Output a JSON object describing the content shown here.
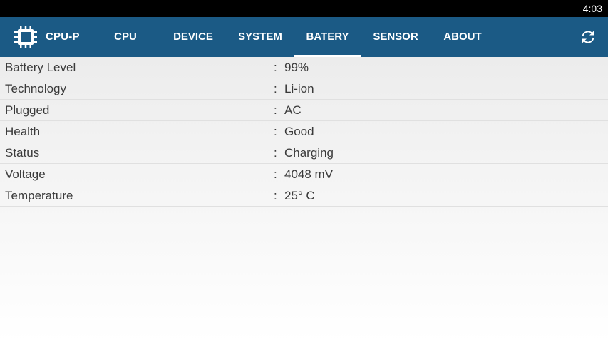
{
  "status_bar": {
    "time": "4:03"
  },
  "app_bar": {
    "title": "CPU-P",
    "tabs": [
      {
        "label": "CPU"
      },
      {
        "label": "DEVICE"
      },
      {
        "label": "SYSTEM"
      },
      {
        "label": "BATERY",
        "selected": true
      },
      {
        "label": "SENSOR"
      },
      {
        "label": "ABOUT"
      }
    ],
    "refresh_icon": "refresh-icon",
    "logo_icon": "chip-icon",
    "colors": {
      "bar": "#1b5a85",
      "text": "#ffffff"
    }
  },
  "battery": {
    "separator": ":",
    "rows": [
      {
        "label": "Battery Level",
        "value": "99%"
      },
      {
        "label": "Technology",
        "value": "Li-ion"
      },
      {
        "label": "Plugged",
        "value": "AC"
      },
      {
        "label": "Health",
        "value": "Good"
      },
      {
        "label": "Status",
        "value": "Charging"
      },
      {
        "label": "Voltage",
        "value": "4048 mV"
      },
      {
        "label": "Temperature",
        "value": "25° C"
      }
    ]
  }
}
